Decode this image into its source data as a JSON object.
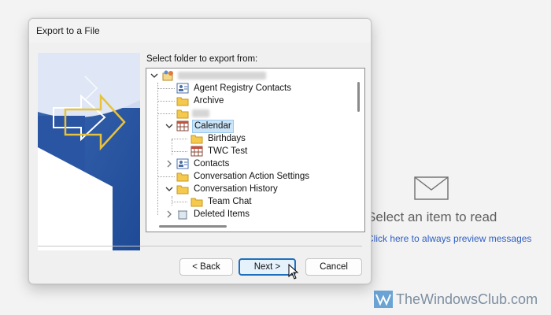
{
  "dialog": {
    "title": "Export to a File",
    "folder_prompt": "Select folder to export from:",
    "tree": [
      {
        "label": "",
        "icon": "mailbox-account-icon",
        "redacted": true,
        "expanded": true
      },
      {
        "label": "Agent Registry Contacts",
        "icon": "contacts-folder-icon"
      },
      {
        "label": "Archive",
        "icon": "folder-icon"
      },
      {
        "label": "",
        "icon": "folder-icon",
        "redacted": true
      },
      {
        "label": "Calendar",
        "icon": "calendar-icon",
        "expanded": true,
        "selected": true
      },
      {
        "label": "Birthdays",
        "icon": "folder-icon"
      },
      {
        "label": "TWC Test",
        "icon": "calendar-icon"
      },
      {
        "label": "Contacts",
        "icon": "contacts-folder-icon",
        "collapsed": true
      },
      {
        "label": "Conversation Action Settings",
        "icon": "folder-icon"
      },
      {
        "label": "Conversation History",
        "icon": "folder-icon",
        "expanded": true
      },
      {
        "label": "Team Chat",
        "icon": "folder-icon"
      },
      {
        "label": "Deleted Items",
        "icon": "deleted-items-icon"
      }
    ],
    "buttons": {
      "back": "< Back",
      "next": "Next >",
      "cancel": "Cancel"
    }
  },
  "reading_pane": {
    "title": "Select an item to read",
    "link": "Click here to always preview messages"
  },
  "watermark": "TheWindowsClub.com",
  "colors": {
    "selection": "#cce4f7",
    "primary_button_border": "#1f6fbf",
    "link": "#2f5fc4"
  }
}
